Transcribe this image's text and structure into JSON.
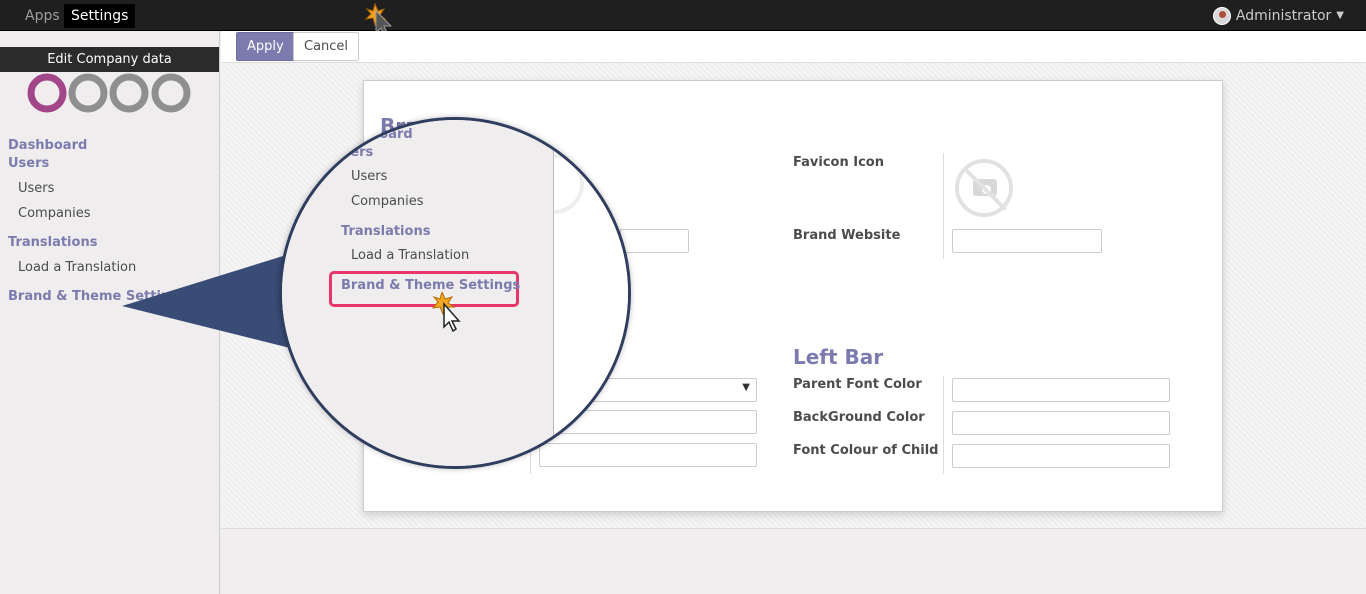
{
  "topbar": {
    "apps_label": "Apps",
    "settings_label": "Settings",
    "user_name": "Administrator"
  },
  "sidebar": {
    "tooltip": "Edit Company data",
    "menu": {
      "dashboard": "Dashboard",
      "users_header": "Users",
      "users_item": "Users",
      "companies_item": "Companies",
      "translations_header": "Translations",
      "load_translation_item": "Load a Translation",
      "brand_theme": "Brand & Theme Setting"
    }
  },
  "toolbar": {
    "apply_label": "Apply",
    "cancel_label": "Cancel"
  },
  "form": {
    "favicon_label": "Favicon Icon",
    "brand_website_label": "Brand Website",
    "left_bar_title": "Left Bar",
    "parent_font_color_label": "Parent Font Color",
    "background_color_label": "BackGround Color",
    "font_colour_child_label": "Font Colour of Child",
    "partial_title": "Bra"
  },
  "magnifier": {
    "dashboard_partial": "board",
    "users_header": "Users",
    "users_item": "Users",
    "companies_item": "Companies",
    "translations_header": "Translations",
    "load_translation_item": "Load a Translation",
    "brand_theme_item": "Brand & Theme Settings"
  },
  "colors": {
    "accent": "#7c7bad",
    "highlight": "#e8366a",
    "magnifier_border": "#2f3d5e",
    "topbar": "#1f1f1f"
  }
}
